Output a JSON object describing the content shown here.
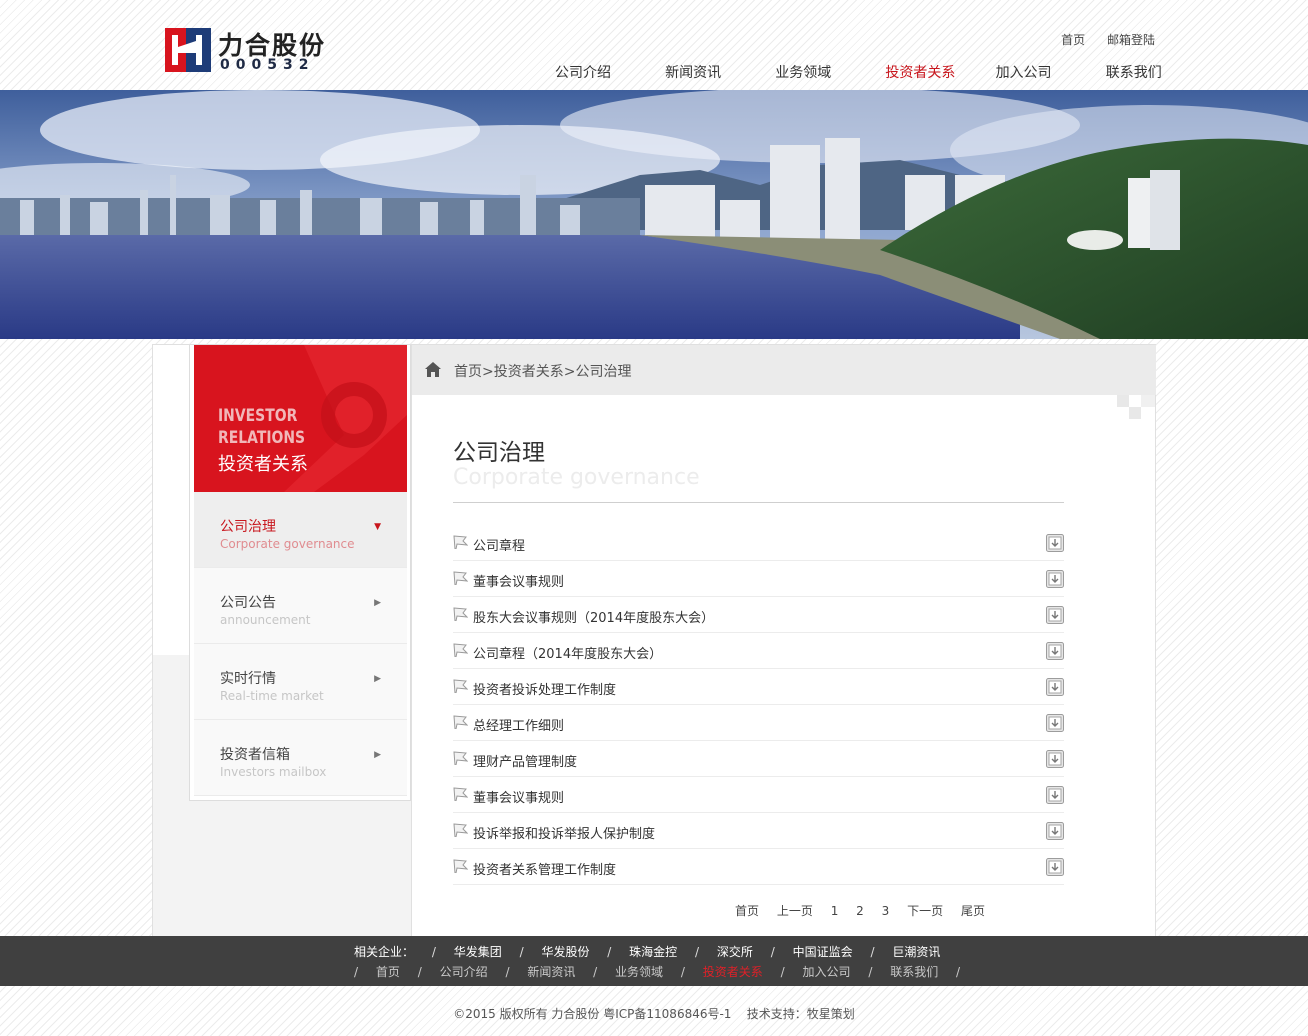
{
  "header": {
    "logo_name": "力合股份",
    "logo_code": "000532",
    "top_links": [
      "首页",
      "邮箱登陆"
    ],
    "nav": [
      {
        "label": "公司介绍",
        "active": false
      },
      {
        "label": "新闻资讯",
        "active": false
      },
      {
        "label": "业务领域",
        "active": false
      },
      {
        "label": "投资者关系",
        "active": true
      },
      {
        "label": "加入公司",
        "active": false
      },
      {
        "label": "联系我们",
        "active": false
      }
    ]
  },
  "sidebar": {
    "title_en_line1": "INVESTOR",
    "title_en_line2": "RELATIONS",
    "title_cn": "投资者关系",
    "items": [
      {
        "cn": "公司治理",
        "en": "Corporate governance",
        "active": true
      },
      {
        "cn": "公司公告",
        "en": "announcement",
        "active": false
      },
      {
        "cn": "实时行情",
        "en": "Real-time market",
        "active": false
      },
      {
        "cn": "投资者信箱",
        "en": "Investors mailbox",
        "active": false
      }
    ]
  },
  "breadcrumb": "首页>投资者关系>公司治理",
  "main": {
    "title": "公司治理",
    "subtitle": "Corporate governance",
    "documents": [
      "公司章程",
      "董事会议事规则",
      "股东大会议事规则（2014年度股东大会）",
      "公司章程（2014年度股东大会）",
      "投资者投诉处理工作制度",
      "总经理工作细则",
      "理财产品管理制度",
      "董事会议事规则",
      "投诉举报和投诉举报人保护制度",
      "投资者关系管理工作制度"
    ]
  },
  "pager": [
    "首页",
    "上一页",
    "1",
    "2",
    "3",
    "下一页",
    "尾页"
  ],
  "footer": {
    "related_label": "相关企业：",
    "related": [
      "华发集团",
      "华发股份",
      "珠海金控",
      "深交所",
      "中国证监会",
      "巨潮资讯"
    ],
    "nav": [
      "首页",
      "公司介绍",
      "新闻资讯",
      "业务领域",
      "投资者关系",
      "加入公司",
      "联系我们"
    ],
    "nav_active_index": 4,
    "separator": "/",
    "copyright": "©2015 版权所有 力合股份 粤ICP备11086846号-1    技术支持：牧星策划"
  },
  "colors": {
    "accent_red": "#c8161d",
    "sidebar_red": "#d8141e",
    "footer_bg": "#404040"
  }
}
